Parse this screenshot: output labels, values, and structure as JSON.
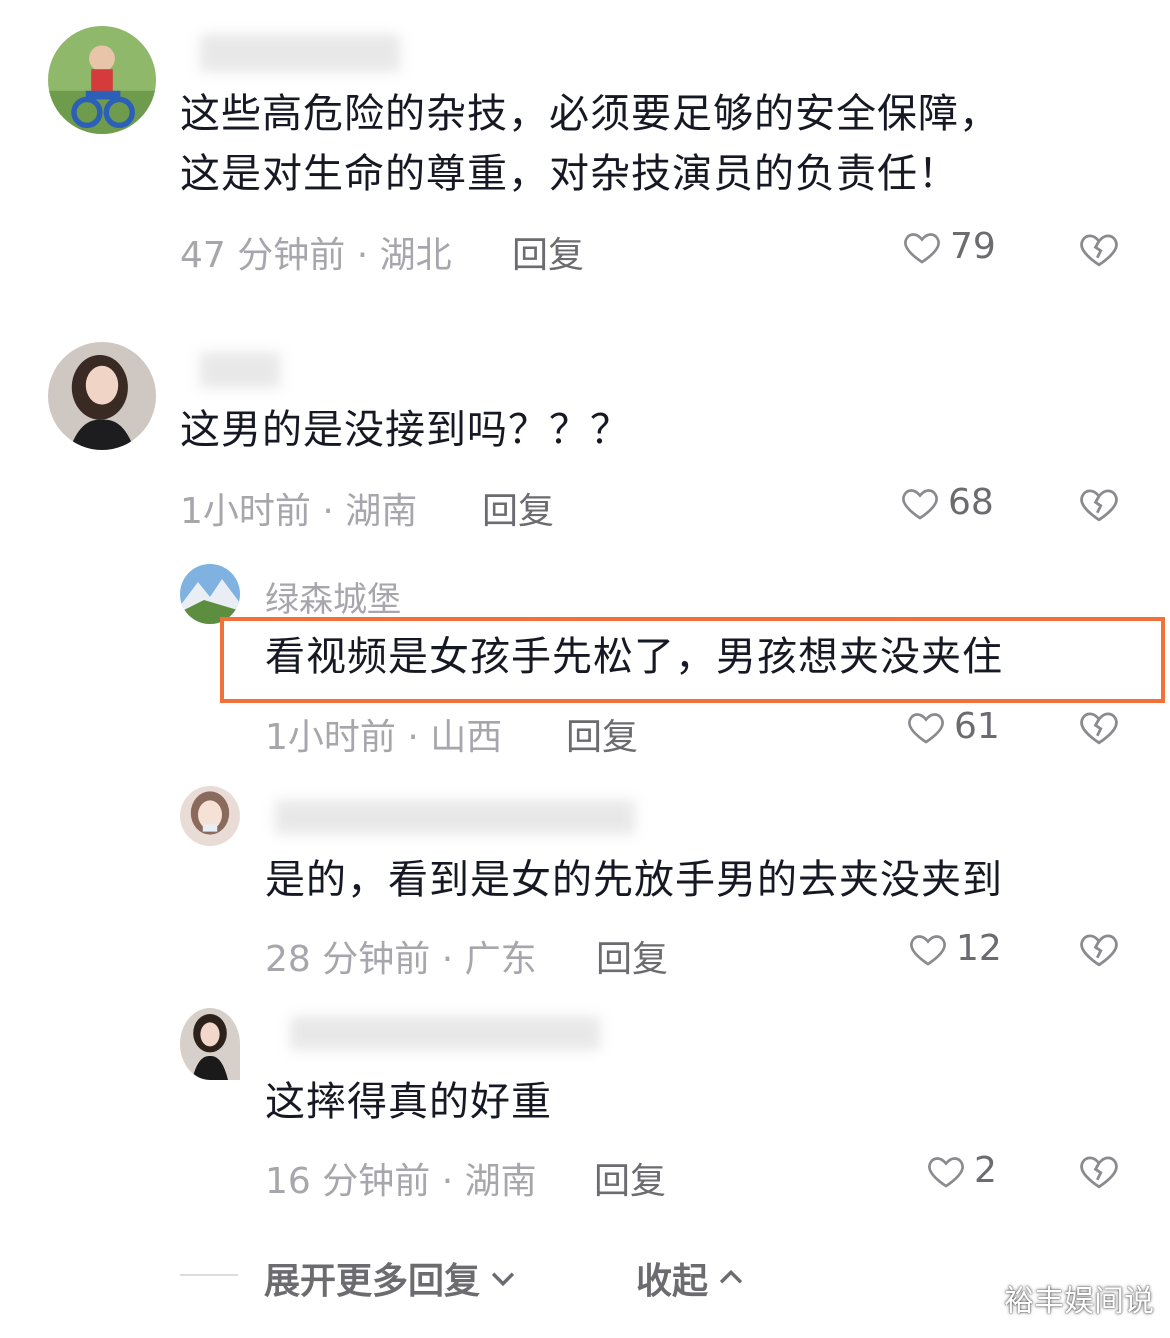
{
  "comments": [
    {
      "text_lines": [
        "这些高危险的杂技，必须要足够的安全保障，",
        "这是对生命的尊重，对杂技演员的负责任！"
      ],
      "time_location": "47 分钟前 · 湖北",
      "reply_label": "回复",
      "likes": "79"
    },
    {
      "text_lines": [
        "这男的是没接到吗？？？"
      ],
      "time_location": "1小时前 · 湖南",
      "reply_label": "回复",
      "likes": "68",
      "replies": [
        {
          "username": "绿森城堡",
          "text": "看视频是女孩手先松了，男孩想夹没夹住",
          "time_location": "1小时前 · 山西",
          "reply_label": "回复",
          "likes": "61",
          "highlighted": true
        },
        {
          "text": "是的，看到是女的先放手男的去夹没夹到",
          "time_location": "28 分钟前 · 广东",
          "reply_label": "回复",
          "likes": "12"
        },
        {
          "text": "这摔得真的好重",
          "time_location": "16 分钟前 · 湖南",
          "reply_label": "回复",
          "likes": "2"
        }
      ]
    }
  ],
  "footer": {
    "expand_label": "展开更多回复",
    "collapse_label": "收起"
  },
  "watermark": "裕丰娱间说",
  "colors": {
    "text": "#161823",
    "meta": "#a6a6ac",
    "highlight_border": "#f2703a"
  },
  "icons": [
    "heart-icon",
    "broken-heart-icon",
    "chevron-down-icon",
    "chevron-up-icon"
  ]
}
